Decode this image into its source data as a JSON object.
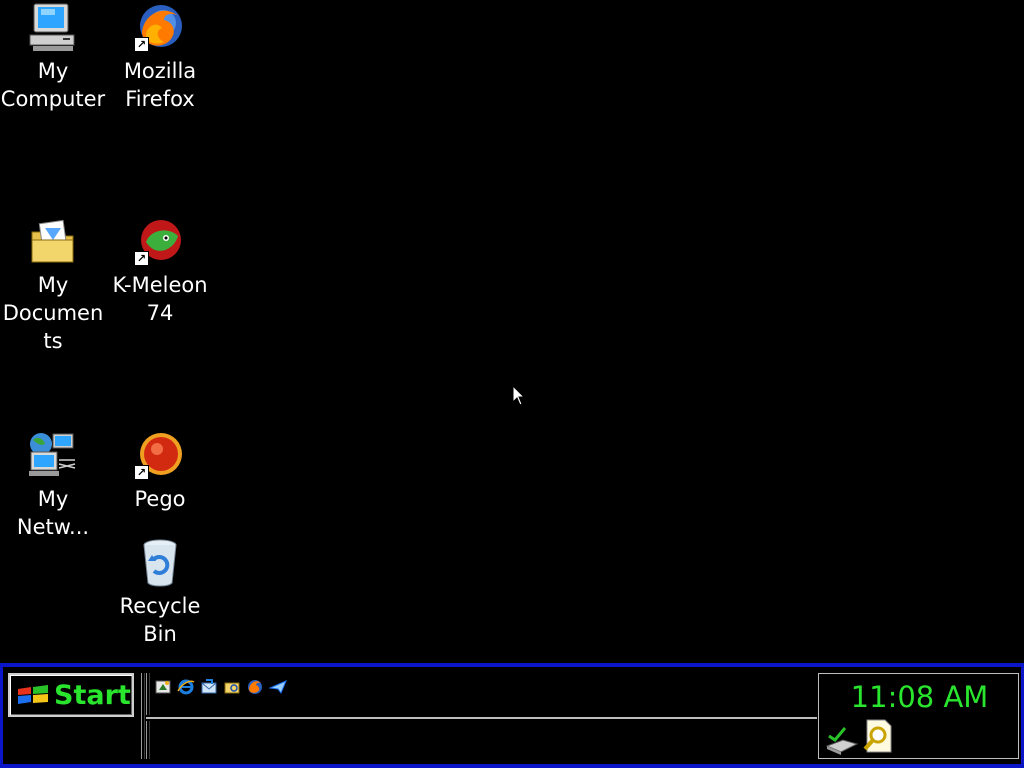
{
  "desktop": {
    "icons": [
      {
        "label": "My\nComputer",
        "icon": "my-computer-icon"
      },
      {
        "label": "Mozilla\nFirefox",
        "icon": "firefox-icon",
        "shortcut": true
      },
      {
        "label": "My\nDocumen\nts",
        "icon": "my-documents-icon"
      },
      {
        "label": "K-Meleon\n74",
        "icon": "k-meleon-icon",
        "shortcut": true
      },
      {
        "label": "My\nNetw...",
        "icon": "network-icon"
      },
      {
        "label": "Pego",
        "icon": "pego-icon",
        "shortcut": true
      },
      {
        "label": "Recycle\nBin",
        "icon": "recycle-bin-icon"
      }
    ]
  },
  "taskbar": {
    "start_label": "Start",
    "quick_launch": [
      "show-desktop-icon",
      "internet-explorer-icon",
      "outlook-express-icon",
      "explorer-icon",
      "firefox-icon",
      "messenger-icon"
    ],
    "tray": {
      "clock": "11:08 AM",
      "icons": [
        "network-status-icon",
        "search-icon"
      ]
    }
  },
  "colors": {
    "desktop_bg": "#000000",
    "taskbar_border": "#0a16c8",
    "accent_green": "#29e52d",
    "label_text": "#ffffff"
  }
}
